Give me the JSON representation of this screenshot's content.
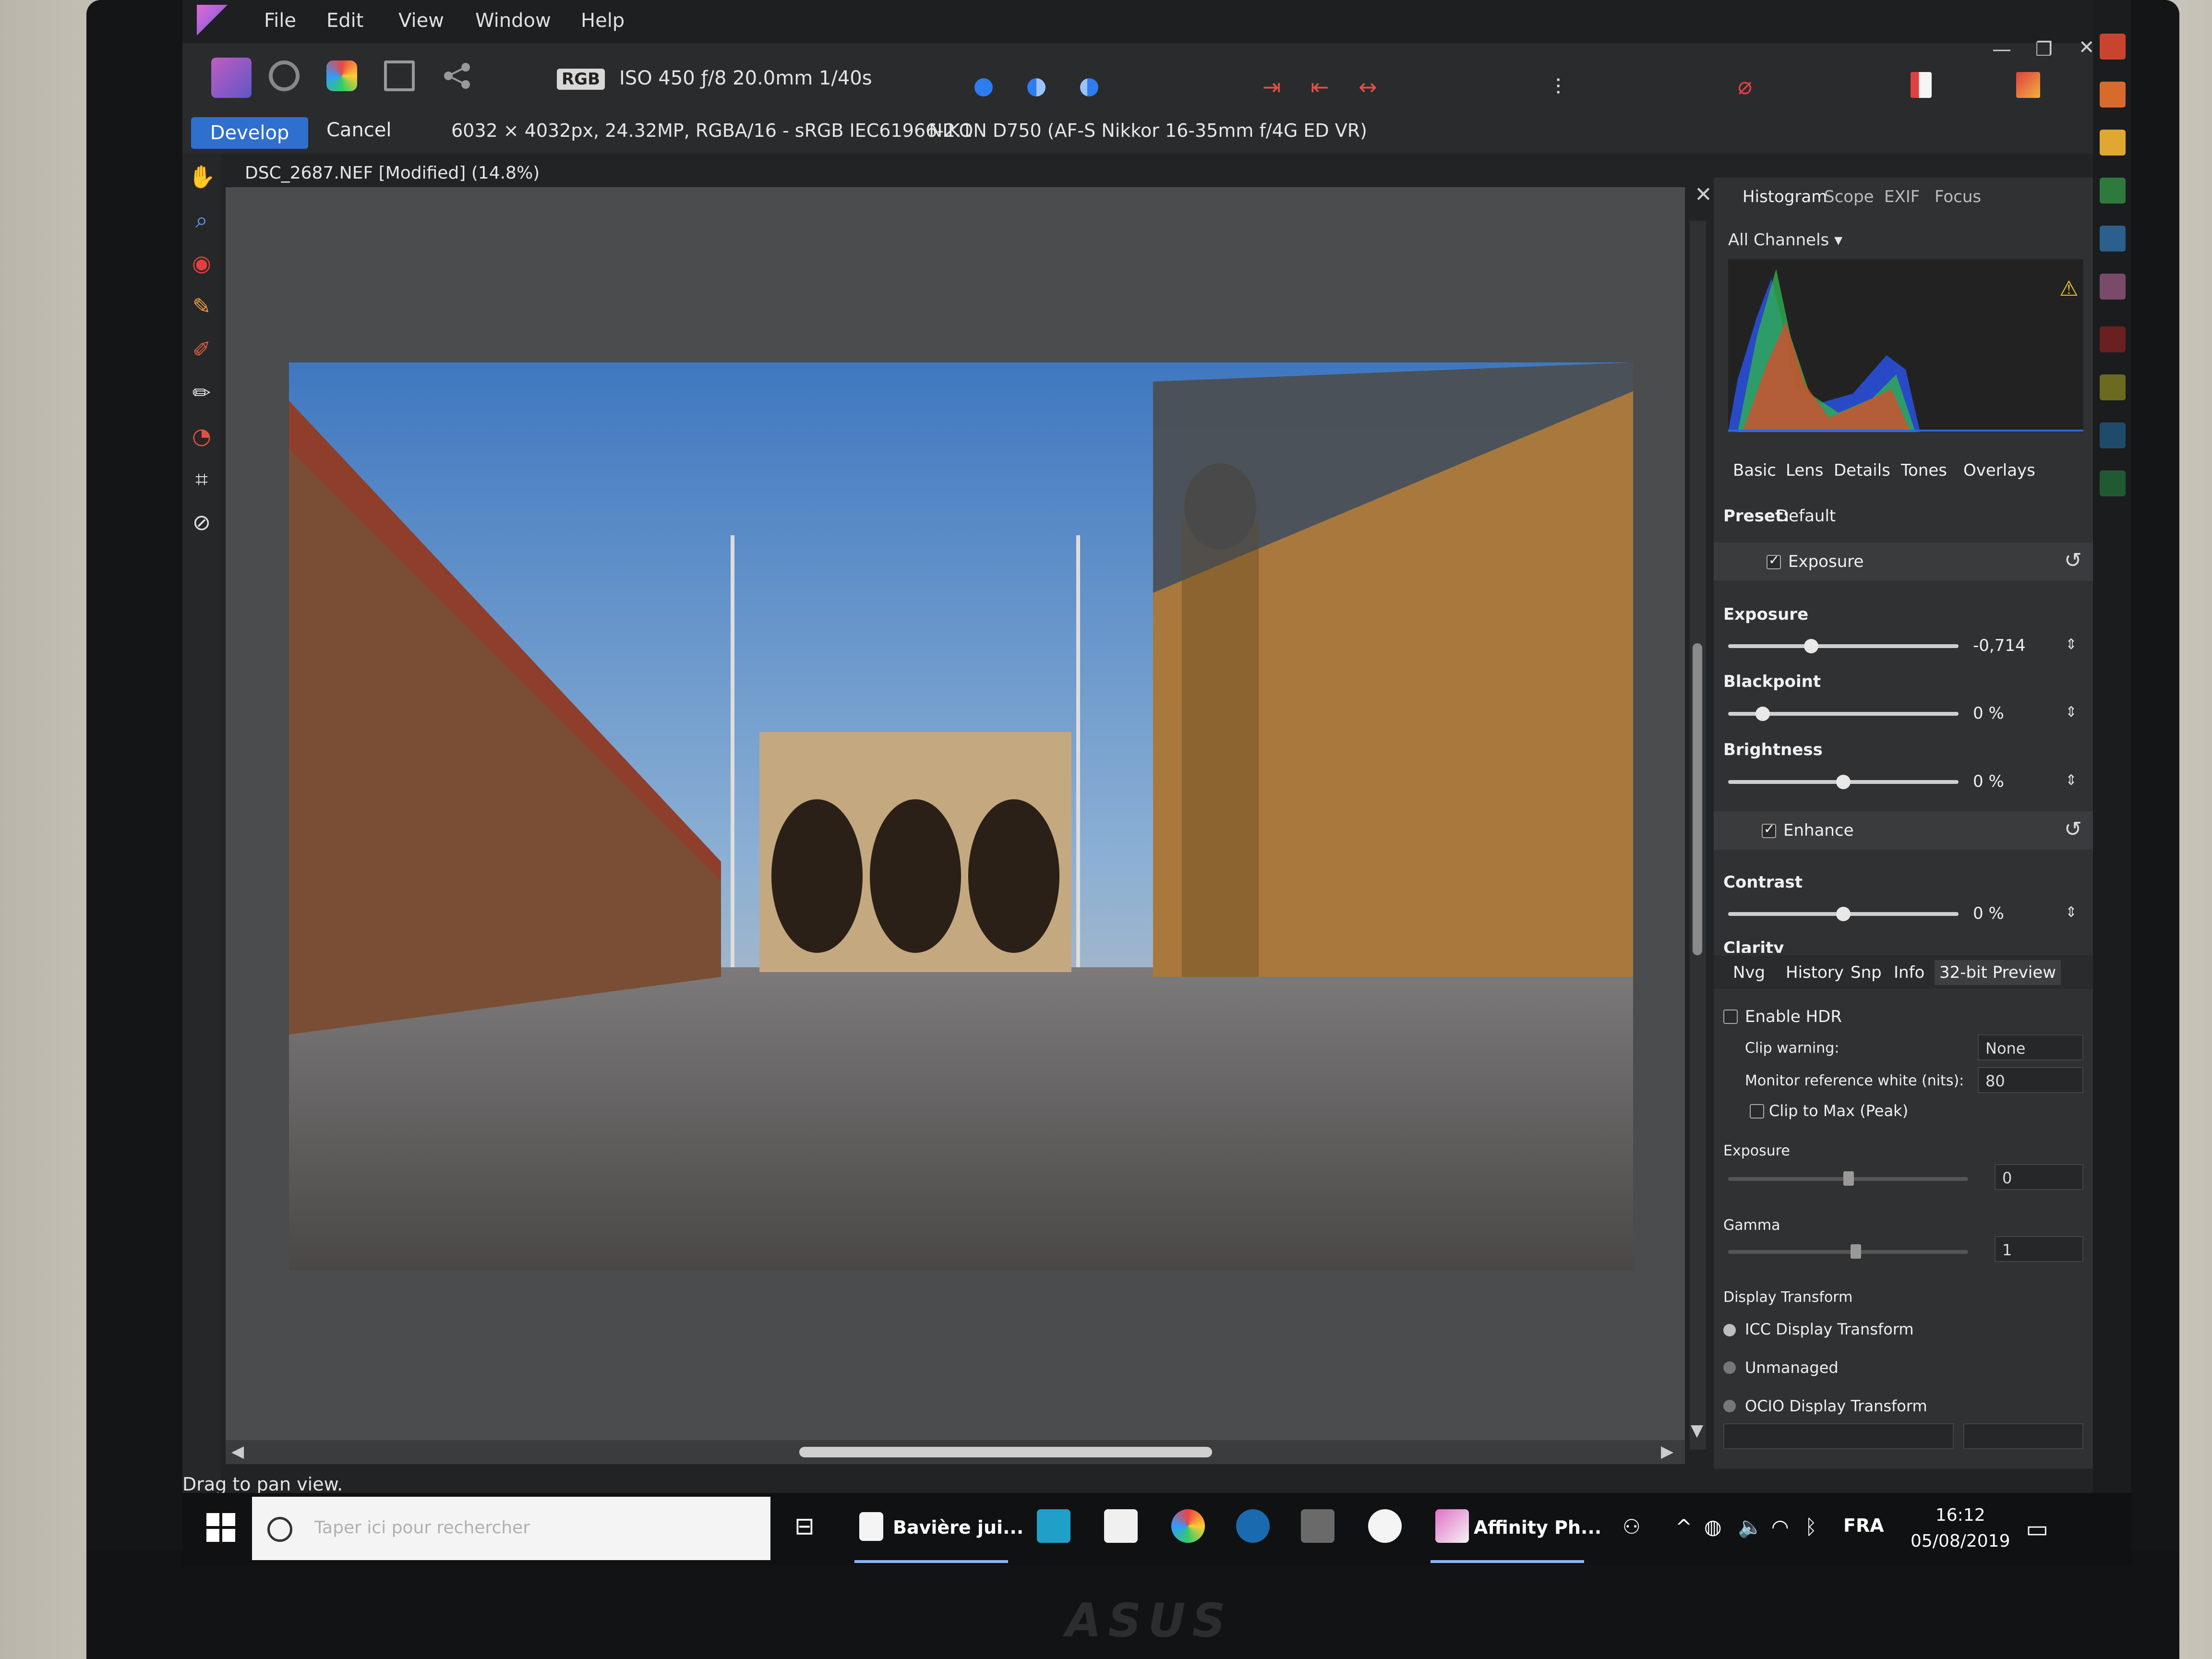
{
  "app": {
    "menu": [
      "File",
      "Edit",
      "View",
      "Window",
      "Help"
    ],
    "toolbar": {
      "color_mode": "RGB",
      "exif_summary": "ISO 450 ƒ/8 20.0mm 1/40s"
    },
    "context": {
      "develop_label": "Develop",
      "cancel_label": "Cancel",
      "image_info": "6032 × 4032px, 24.32MP, RGBA/16 - sRGB IEC61966-2.1",
      "camera_info": "NIKON D750 (AF-S Nikkor 16-35mm f/4G ED VR)"
    },
    "document_title": "DSC_2687.NEF [Modified] (14.8%)",
    "status_text": "Drag to pan view."
  },
  "panels": {
    "top_tabs": [
      "Histogram",
      "Scope",
      "EXIF",
      "Focus"
    ],
    "channels_label": "All Channels",
    "dev_tabs": [
      "Basic",
      "Lens",
      "Details",
      "Tones",
      "Overlays"
    ],
    "preset_label": "Preset:",
    "preset_value": "Default",
    "exposure_section": "Exposure",
    "exposure": {
      "label": "Exposure",
      "value": "-0,714",
      "level": 0.36
    },
    "blackpoint": {
      "label": "Blackpoint",
      "value": "0 %",
      "level": 0.15
    },
    "brightness": {
      "label": "Brightness",
      "value": "0 %",
      "level": 0.5
    },
    "enhance_section": "Enhance",
    "contrast": {
      "label": "Contrast",
      "value": "0 %",
      "level": 0.5
    },
    "clarity_label": "Clarity",
    "bottom_tabs": [
      "Nvg",
      "History",
      "Snp",
      "Info",
      "32-bit Preview"
    ],
    "hdr": {
      "enable_label": "Enable HDR",
      "clip_warning_label": "Clip warning:",
      "clip_warning_value": "None",
      "monitor_white_label": "Monitor reference white (nits):",
      "monitor_white_value": "80",
      "clip_to_max_label": "Clip to Max (Peak)",
      "exposure_label": "Exposure",
      "exposure_value": "0",
      "gamma_label": "Gamma",
      "gamma_value": "1",
      "display_transform_label": "Display Transform",
      "options": [
        "ICC Display Transform",
        "Unmanaged",
        "OCIO Display Transform"
      ]
    }
  },
  "taskbar": {
    "search_placeholder": "Taper ici pour rechercher",
    "app1_label": "Bavière jui...",
    "app2_label": "Affinity Ph...",
    "language": "FRA",
    "time": "16:12",
    "date": "05/08/2019"
  },
  "monitor_brand": "ASUS",
  "colors": {
    "accent": "#2f6fce",
    "panel_bg": "#303133",
    "canvas_bg": "#4b4c4e"
  }
}
